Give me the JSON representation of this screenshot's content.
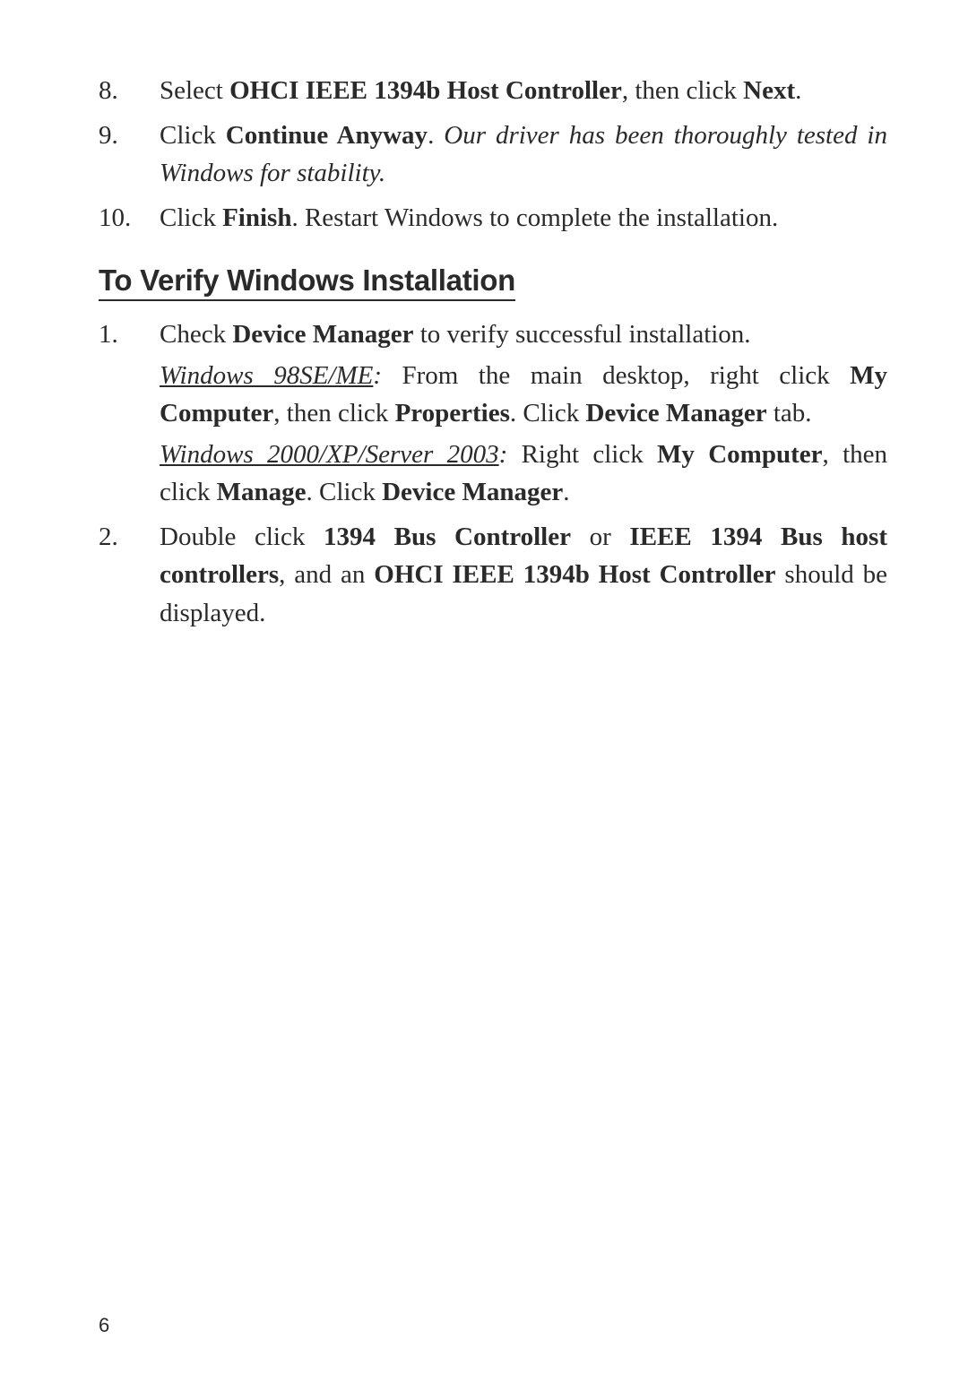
{
  "top_list": {
    "items": [
      {
        "num": "8.",
        "text_parts": [
          {
            "t": "Select ",
            "cls": ""
          },
          {
            "t": "OHCI IEEE 1394b Host Controller",
            "cls": "bold"
          },
          {
            "t": ", then click ",
            "cls": ""
          },
          {
            "t": "Next",
            "cls": "bold"
          },
          {
            "t": ".",
            "cls": ""
          }
        ]
      },
      {
        "num": "9.",
        "text_parts": [
          {
            "t": "Click ",
            "cls": ""
          },
          {
            "t": "Continue Anyway",
            "cls": "bold"
          },
          {
            "t": ".   ",
            "cls": ""
          },
          {
            "t": "Our driver has been thoroughly tested in Windows for stability.",
            "cls": "italic"
          }
        ]
      },
      {
        "num": "10.",
        "text_parts": [
          {
            "t": "Click ",
            "cls": ""
          },
          {
            "t": "Finish",
            "cls": "bold"
          },
          {
            "t": ".   Restart Windows to complete the installation.",
            "cls": ""
          }
        ]
      }
    ]
  },
  "heading": "To Verify Windows Installation",
  "verify_list": {
    "items": [
      {
        "num": "1.",
        "blocks": [
          {
            "parts": [
              {
                "t": "Check ",
                "cls": ""
              },
              {
                "t": "Device Manager",
                "cls": "bold"
              },
              {
                "t": " to verify successful installation.",
                "cls": ""
              }
            ]
          },
          {
            "parts": [
              {
                "t": "Windows 98SE/ME",
                "cls": "underline-italic"
              },
              {
                "t": ":",
                "cls": "italic"
              },
              {
                "t": " From the main desktop, right click ",
                "cls": ""
              },
              {
                "t": "My Computer",
                "cls": "bold"
              },
              {
                "t": ", then click ",
                "cls": ""
              },
              {
                "t": "Properties",
                "cls": "bold"
              },
              {
                "t": ".  Click ",
                "cls": ""
              },
              {
                "t": "Device Manager",
                "cls": "bold"
              },
              {
                "t": " tab.",
                "cls": ""
              }
            ]
          },
          {
            "parts": [
              {
                "t": "Windows 2000/XP/Server 2003",
                "cls": "underline-italic"
              },
              {
                "t": ":",
                "cls": "italic"
              },
              {
                "t": "  Right click ",
                "cls": ""
              },
              {
                "t": "My Computer",
                "cls": "bold"
              },
              {
                "t": ", then click ",
                "cls": ""
              },
              {
                "t": "Manage",
                "cls": "bold"
              },
              {
                "t": ".  Click ",
                "cls": ""
              },
              {
                "t": "Device Manager",
                "cls": "bold"
              },
              {
                "t": ".",
                "cls": ""
              }
            ]
          }
        ]
      },
      {
        "num": "2.",
        "blocks": [
          {
            "parts": [
              {
                "t": "Double click ",
                "cls": ""
              },
              {
                "t": "1394 Bus Controller",
                "cls": "bold"
              },
              {
                "t": " or ",
                "cls": ""
              },
              {
                "t": "IEEE 1394 Bus host controllers",
                "cls": "bold"
              },
              {
                "t": ", and an ",
                "cls": ""
              },
              {
                "t": "OHCI IEEE 1394b Host Controller",
                "cls": "bold"
              },
              {
                "t": " should be displayed.",
                "cls": ""
              }
            ]
          }
        ]
      }
    ]
  },
  "page_number": "6"
}
